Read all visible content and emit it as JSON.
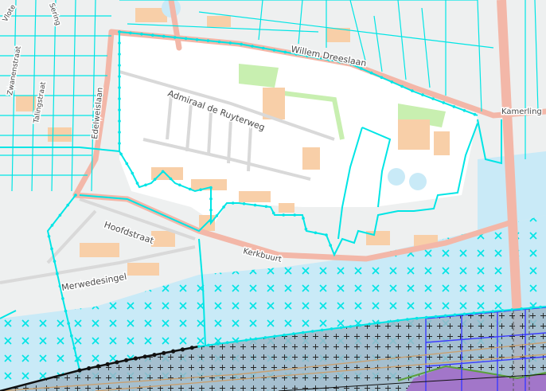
{
  "map": {
    "colors": {
      "land": "#eef0f0",
      "water": "#c9eaf7",
      "parcel": "#00e5e5",
      "road_major": "#f3b7a8",
      "road_minor": "#cfcfcf",
      "building": "#f8cfa8",
      "green": "#c8efb0",
      "hatch_area": "#9fb7c8",
      "purple_area": "#a276c9",
      "grid_blue": "#3b3bff",
      "contour": "#000000"
    },
    "street_labels": [
      {
        "text": "Willem Dreeslaan",
        "angle": 11
      },
      {
        "text": "Admiraal de Ruyterweg",
        "angle": 20
      },
      {
        "text": "Kerkbuurt",
        "angle": 13
      },
      {
        "text": "Hoofdstraat",
        "angle": 19
      },
      {
        "text": "Merwedesingel",
        "angle": -10
      },
      {
        "text": "Edelweislaan",
        "angle": -84
      },
      {
        "text": "Talingstraat",
        "angle": -80
      },
      {
        "text": "Zwanenstraat",
        "angle": -80
      },
      {
        "text": "Kamerling",
        "angle": 0
      },
      {
        "text": "Vlote",
        "angle": -60
      },
      {
        "text": "Sering",
        "angle": 72
      }
    ]
  }
}
